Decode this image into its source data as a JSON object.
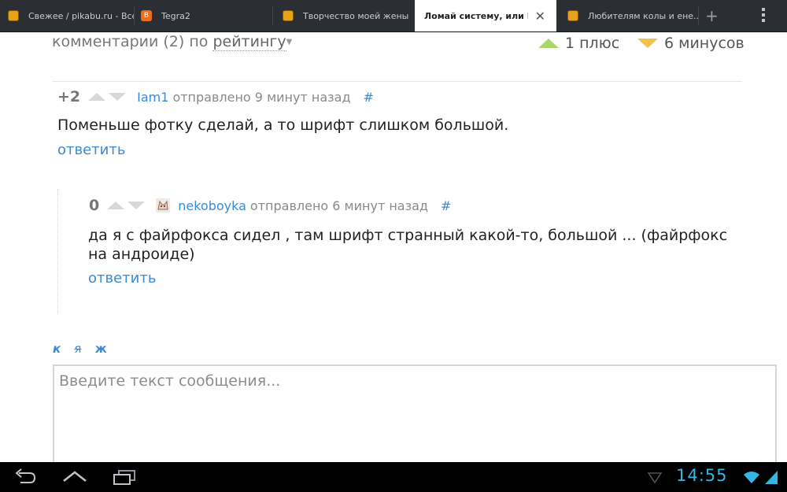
{
  "tabs": [
    {
      "title": "Свежее / pikabu.ru - Все",
      "icon": "pikabu-icon",
      "active": false
    },
    {
      "title": "Tegra2",
      "icon": "blogger-icon",
      "active": false
    },
    {
      "title": "Творчество моей жены",
      "icon": "pikabu-icon",
      "active": false
    },
    {
      "title": "Ломай систему, или Ма...",
      "icon": "pikabu-icon",
      "active": true
    },
    {
      "title": "Любителям колы и ене...",
      "icon": "pikabu-icon",
      "active": false
    }
  ],
  "header": {
    "comments_label": "комментарии (2) по",
    "sort_value": "рейтингу",
    "plus_label": "1 плюс",
    "minus_label": "6 минусов"
  },
  "comments": [
    {
      "score": "+2",
      "user": "Iam1",
      "posted": "отправлено 9 минут назад",
      "hash": "#",
      "text": "Поменьше фотку сделай, а то шрифт слишком большой.",
      "reply": "ответить"
    },
    {
      "score": "0",
      "user": "nekoboyka",
      "posted": "отправлено 6 минут назад",
      "hash": "#",
      "text": "да я с файрфокса сидел , там шрифт странный какой-то, большой ... (файрфокс на андроиде)",
      "reply": "ответить"
    }
  ],
  "format": {
    "italic": "к",
    "strike": "я",
    "bold": "ж"
  },
  "message": {
    "placeholder": "Введите текст сообщения..."
  },
  "status": {
    "time": "14:55"
  },
  "colors": {
    "link": "#3a8ad6",
    "clock": "#33b5e5",
    "plus": "#a9d86a",
    "minus": "#f2c24a"
  }
}
